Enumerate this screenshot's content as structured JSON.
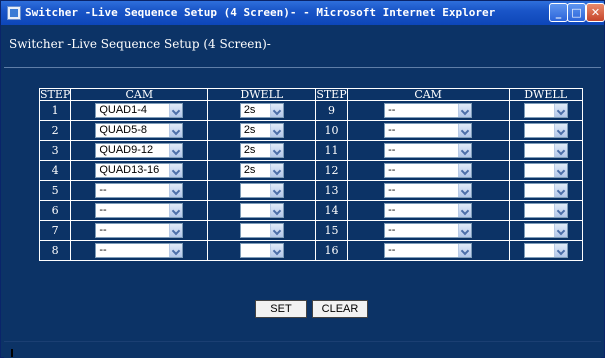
{
  "window": {
    "title": "Switcher -Live Sequence Setup (4 Screen)- - Microsoft Internet Explorer",
    "controls": {
      "minimize": "_",
      "maximize": "□",
      "close": "✕"
    }
  },
  "page": {
    "heading": "Switcher -Live Sequence Setup (4 Screen)-"
  },
  "table": {
    "headers": {
      "step": "STEP",
      "cam": "CAM",
      "dwell": "DWELL"
    },
    "left": [
      {
        "step": "1",
        "cam": "QUAD1-4",
        "dwell": "2s"
      },
      {
        "step": "2",
        "cam": "QUAD5-8",
        "dwell": "2s"
      },
      {
        "step": "3",
        "cam": "QUAD9-12",
        "dwell": "2s"
      },
      {
        "step": "4",
        "cam": "QUAD13-16",
        "dwell": "2s"
      },
      {
        "step": "5",
        "cam": "--",
        "dwell": ""
      },
      {
        "step": "6",
        "cam": "--",
        "dwell": ""
      },
      {
        "step": "7",
        "cam": "--",
        "dwell": ""
      },
      {
        "step": "8",
        "cam": "--",
        "dwell": ""
      }
    ],
    "right": [
      {
        "step": "9",
        "cam": "--",
        "dwell": ""
      },
      {
        "step": "10",
        "cam": "--",
        "dwell": ""
      },
      {
        "step": "11",
        "cam": "--",
        "dwell": ""
      },
      {
        "step": "12",
        "cam": "--",
        "dwell": ""
      },
      {
        "step": "13",
        "cam": "--",
        "dwell": ""
      },
      {
        "step": "14",
        "cam": "--",
        "dwell": ""
      },
      {
        "step": "15",
        "cam": "--",
        "dwell": ""
      },
      {
        "step": "16",
        "cam": "--",
        "dwell": ""
      }
    ]
  },
  "buttons": {
    "set": "SET",
    "clear": "CLEAR"
  }
}
